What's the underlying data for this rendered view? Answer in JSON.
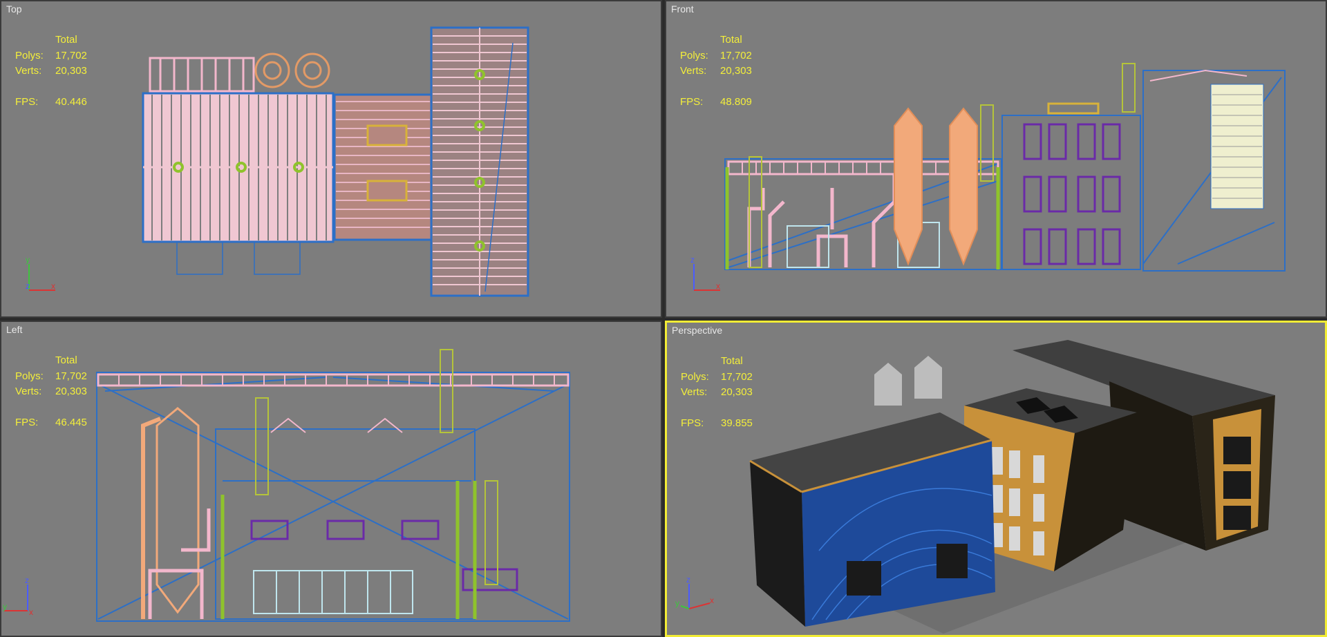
{
  "viewports": {
    "top": {
      "label": "Top",
      "stats": {
        "header": "Total",
        "polys_label": "Polys:",
        "polys": "17,702",
        "verts_label": "Verts:",
        "verts": "20,303",
        "fps_label": "FPS:",
        "fps": "40.446"
      }
    },
    "front": {
      "label": "Front",
      "stats": {
        "header": "Total",
        "polys_label": "Polys:",
        "polys": "17,702",
        "verts_label": "Verts:",
        "verts": "20,303",
        "fps_label": "FPS:",
        "fps": "48.809"
      }
    },
    "left": {
      "label": "Left",
      "stats": {
        "header": "Total",
        "polys_label": "Polys:",
        "polys": "17,702",
        "verts_label": "Verts:",
        "verts": "20,303",
        "fps_label": "FPS:",
        "fps": "46.445"
      }
    },
    "persp": {
      "label": "Perspective",
      "stats": {
        "header": "Total",
        "polys_label": "Polys:",
        "polys": "17,702",
        "verts_label": "Verts:",
        "verts": "20,303",
        "fps_label": "FPS:",
        "fps": "39.855"
      }
    }
  },
  "axis_labels": {
    "x": "x",
    "y": "y",
    "z": "z"
  },
  "colors": {
    "viewport_bg": "#7d7d7d",
    "active_border": "#f2ec35",
    "stats_text": "#f4ef3a",
    "wire_blue": "#2c6fc7",
    "wire_pink": "#f3b7cc",
    "wire_green": "#8fc32c",
    "wire_orange": "#f2a97a",
    "wire_purple": "#6a2aa8"
  },
  "icons": [
    "axis-tripod-icon"
  ]
}
